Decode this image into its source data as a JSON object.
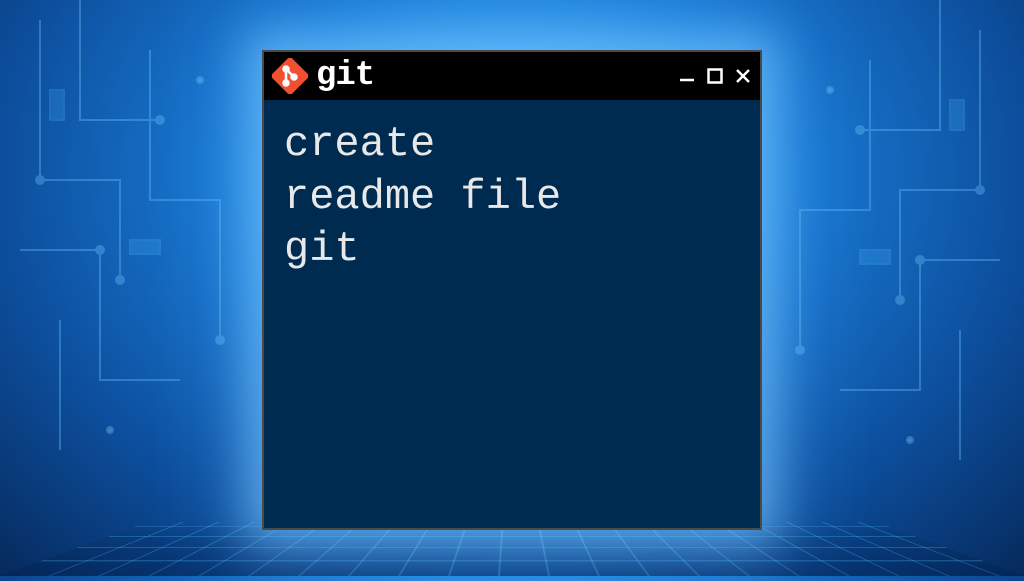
{
  "window": {
    "title": "git"
  },
  "terminal": {
    "content": "create\nreadme file\ngit"
  },
  "colors": {
    "git_logo_bg": "#f14e32",
    "terminal_bg": "#002b50",
    "titlebar_bg": "#000000"
  }
}
